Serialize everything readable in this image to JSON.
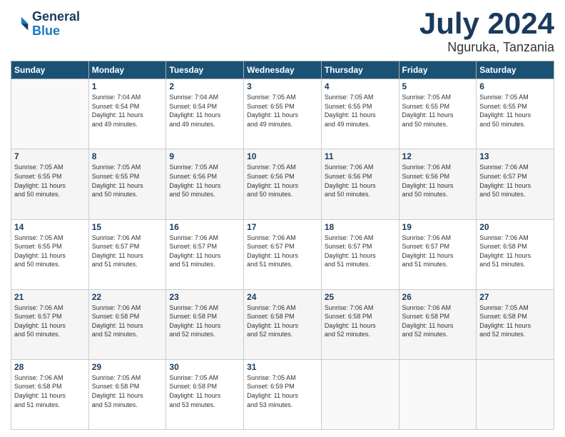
{
  "logo": {
    "line1": "General",
    "line2": "Blue"
  },
  "title": "July 2024",
  "subtitle": "Nguruka, Tanzania",
  "days_of_week": [
    "Sunday",
    "Monday",
    "Tuesday",
    "Wednesday",
    "Thursday",
    "Friday",
    "Saturday"
  ],
  "weeks": [
    [
      {
        "day": "",
        "info": ""
      },
      {
        "day": "1",
        "info": "Sunrise: 7:04 AM\nSunset: 6:54 PM\nDaylight: 11 hours\nand 49 minutes."
      },
      {
        "day": "2",
        "info": "Sunrise: 7:04 AM\nSunset: 6:54 PM\nDaylight: 11 hours\nand 49 minutes."
      },
      {
        "day": "3",
        "info": "Sunrise: 7:05 AM\nSunset: 6:55 PM\nDaylight: 11 hours\nand 49 minutes."
      },
      {
        "day": "4",
        "info": "Sunrise: 7:05 AM\nSunset: 6:55 PM\nDaylight: 11 hours\nand 49 minutes."
      },
      {
        "day": "5",
        "info": "Sunrise: 7:05 AM\nSunset: 6:55 PM\nDaylight: 11 hours\nand 50 minutes."
      },
      {
        "day": "6",
        "info": "Sunrise: 7:05 AM\nSunset: 6:55 PM\nDaylight: 11 hours\nand 50 minutes."
      }
    ],
    [
      {
        "day": "7",
        "info": ""
      },
      {
        "day": "8",
        "info": "Sunrise: 7:05 AM\nSunset: 6:55 PM\nDaylight: 11 hours\nand 50 minutes."
      },
      {
        "day": "9",
        "info": "Sunrise: 7:05 AM\nSunset: 6:56 PM\nDaylight: 11 hours\nand 50 minutes."
      },
      {
        "day": "10",
        "info": "Sunrise: 7:05 AM\nSunset: 6:56 PM\nDaylight: 11 hours\nand 50 minutes."
      },
      {
        "day": "11",
        "info": "Sunrise: 7:06 AM\nSunset: 6:56 PM\nDaylight: 11 hours\nand 50 minutes."
      },
      {
        "day": "12",
        "info": "Sunrise: 7:06 AM\nSunset: 6:56 PM\nDaylight: 11 hours\nand 50 minutes."
      },
      {
        "day": "13",
        "info": "Sunrise: 7:06 AM\nSunset: 6:57 PM\nDaylight: 11 hours\nand 50 minutes."
      }
    ],
    [
      {
        "day": "14",
        "info": ""
      },
      {
        "day": "15",
        "info": "Sunrise: 7:06 AM\nSunset: 6:57 PM\nDaylight: 11 hours\nand 51 minutes."
      },
      {
        "day": "16",
        "info": "Sunrise: 7:06 AM\nSunset: 6:57 PM\nDaylight: 11 hours\nand 51 minutes."
      },
      {
        "day": "17",
        "info": "Sunrise: 7:06 AM\nSunset: 6:57 PM\nDaylight: 11 hours\nand 51 minutes."
      },
      {
        "day": "18",
        "info": "Sunrise: 7:06 AM\nSunset: 6:57 PM\nDaylight: 11 hours\nand 51 minutes."
      },
      {
        "day": "19",
        "info": "Sunrise: 7:06 AM\nSunset: 6:57 PM\nDaylight: 11 hours\nand 51 minutes."
      },
      {
        "day": "20",
        "info": "Sunrise: 7:06 AM\nSunset: 6:58 PM\nDaylight: 11 hours\nand 51 minutes."
      }
    ],
    [
      {
        "day": "21",
        "info": ""
      },
      {
        "day": "22",
        "info": "Sunrise: 7:06 AM\nSunset: 6:58 PM\nDaylight: 11 hours\nand 52 minutes."
      },
      {
        "day": "23",
        "info": "Sunrise: 7:06 AM\nSunset: 6:58 PM\nDaylight: 11 hours\nand 52 minutes."
      },
      {
        "day": "24",
        "info": "Sunrise: 7:06 AM\nSunset: 6:58 PM\nDaylight: 11 hours\nand 52 minutes."
      },
      {
        "day": "25",
        "info": "Sunrise: 7:06 AM\nSunset: 6:58 PM\nDaylight: 11 hours\nand 52 minutes."
      },
      {
        "day": "26",
        "info": "Sunrise: 7:06 AM\nSunset: 6:58 PM\nDaylight: 11 hours\nand 52 minutes."
      },
      {
        "day": "27",
        "info": "Sunrise: 7:05 AM\nSunset: 6:58 PM\nDaylight: 11 hours\nand 52 minutes."
      }
    ],
    [
      {
        "day": "28",
        "info": ""
      },
      {
        "day": "29",
        "info": "Sunrise: 7:05 AM\nSunset: 6:58 PM\nDaylight: 11 hours\nand 53 minutes."
      },
      {
        "day": "30",
        "info": "Sunrise: 7:05 AM\nSunset: 6:58 PM\nDaylight: 11 hours\nand 53 minutes."
      },
      {
        "day": "31",
        "info": "Sunrise: 7:05 AM\nSunset: 6:59 PM\nDaylight: 11 hours\nand 53 minutes."
      },
      {
        "day": "",
        "info": ""
      },
      {
        "day": "",
        "info": ""
      },
      {
        "day": "",
        "info": ""
      }
    ]
  ],
  "week1_day7_info": "Sunrise: 7:05 AM\nSunset: 6:55 PM\nDaylight: 11 hours\nand 50 minutes.",
  "week2_day1_info": "Sunrise: 7:05 AM\nSunset: 6:55 PM\nDaylight: 11 hours\nand 50 minutes.",
  "week3_day1_info": "Sunrise: 7:06 AM\nSunset: 6:57 PM\nDaylight: 11 hours\nand 50 minutes.",
  "week4_day1_info": "Sunrise: 7:06 AM\nSunset: 6:58 PM\nDaylight: 11 hours\nand 51 minutes.",
  "week5_day1_info": "Sunrise: 7:05 AM\nSunset: 6:58 PM\nDaylight: 11 hours\nand 52 minutes."
}
